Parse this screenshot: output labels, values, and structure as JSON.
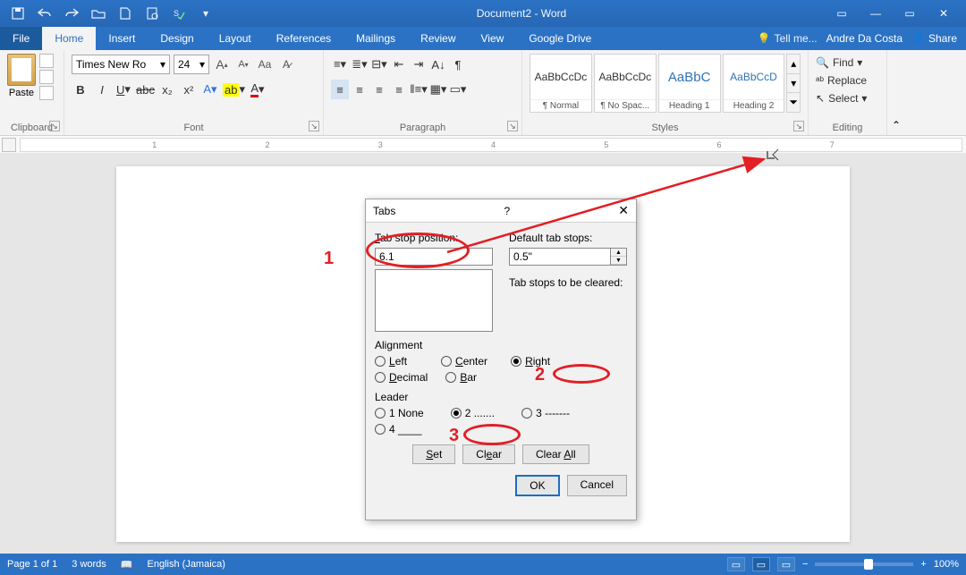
{
  "titlebar": {
    "title": "Document2 - Word"
  },
  "wincontrols": {
    "min": "—",
    "max": "▭",
    "close": "✕",
    "ribbonopts": "▭"
  },
  "menubar": {
    "file": "File",
    "items": [
      "Home",
      "Insert",
      "Design",
      "Layout",
      "References",
      "Mailings",
      "Review",
      "View",
      "Google Drive"
    ],
    "active": 0,
    "tellme": "Tell me...",
    "user": "Andre Da Costa",
    "share": "Share"
  },
  "ribbon": {
    "clipboard": {
      "paste": "Paste",
      "label": "Clipboard"
    },
    "font": {
      "font_name": "Times New Ro",
      "font_size": "24",
      "bold": "B",
      "italic": "I",
      "underline": "U",
      "increase": "A",
      "decrease": "A",
      "aa": "Aa",
      "abc": "abc",
      "x2": "x₂",
      "X2": "x²",
      "label": "Font"
    },
    "paragraph": {
      "label": "Paragraph"
    },
    "styles": {
      "label": "Styles",
      "items": [
        {
          "preview": "AaBbCcDc",
          "name": "¶ Normal"
        },
        {
          "preview": "AaBbCcDc",
          "name": "¶ No Spac..."
        },
        {
          "preview": "AaBbC",
          "name": "Heading 1"
        },
        {
          "preview": "AaBbCcD",
          "name": "Heading 2"
        }
      ]
    },
    "editing": {
      "find": "Find",
      "replace": "Replace",
      "select": "Select",
      "label": "Editing"
    }
  },
  "ruler": {
    "marks": [
      "1",
      "2",
      "3",
      "4",
      "5",
      "6",
      "7"
    ]
  },
  "dialog": {
    "title": "Tabs",
    "help": "?",
    "close": "✕",
    "tab_stop_label": "Tab stop position:",
    "tab_stop_value": "6.1",
    "default_label": "Default tab stops:",
    "default_value": "0.5\"",
    "clear_label": "Tab stops to be cleared:",
    "alignment_label": "Alignment",
    "alignment": {
      "left": "Left",
      "center": "Center",
      "right": "Right",
      "decimal": "Decimal",
      "bar": "Bar"
    },
    "leader_label": "Leader",
    "leader": {
      "l1": "1 None",
      "l2": "2 .......",
      "l3": "3 -------",
      "l4": "4 ____"
    },
    "set": "Set",
    "clear": "Clear",
    "clear_all": "Clear All",
    "ok": "OK",
    "cancel": "Cancel"
  },
  "statusbar": {
    "page": "Page 1 of 1",
    "words": "3 words",
    "lang": "English (Jamaica)",
    "zoom": "100%"
  },
  "annotations": {
    "n1": "1",
    "n2": "2",
    "n3": "3"
  }
}
